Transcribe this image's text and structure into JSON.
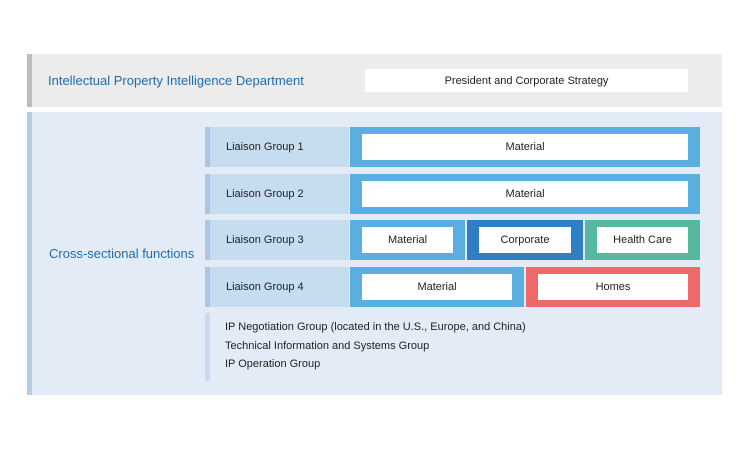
{
  "top": {
    "title": "Intellectual Property Intelligence Department",
    "box": "President and Corporate Strategy"
  },
  "cross": {
    "title": "Cross-sectional functions",
    "groups": [
      {
        "label": "Liaison Group 1",
        "cells": [
          "Material"
        ]
      },
      {
        "label": "Liaison Group 2",
        "cells": [
          "Material"
        ]
      },
      {
        "label": "Liaison Group 3",
        "cells": [
          "Material",
          "Corporate",
          "Health Care"
        ]
      },
      {
        "label": "Liaison Group 4",
        "cells": [
          "Material",
          "Homes"
        ]
      }
    ],
    "functions": [
      "IP Negotiation Group (located in the U.S., Europe, and China)",
      "Technical Information and Systems Group",
      "IP Operation Group"
    ]
  },
  "colors": {
    "material": "#5aaee0",
    "corporate": "#2f7fc4",
    "health_care": "#56b8a0",
    "homes": "#ee6a6a",
    "title_blue": "#1e6bab"
  }
}
